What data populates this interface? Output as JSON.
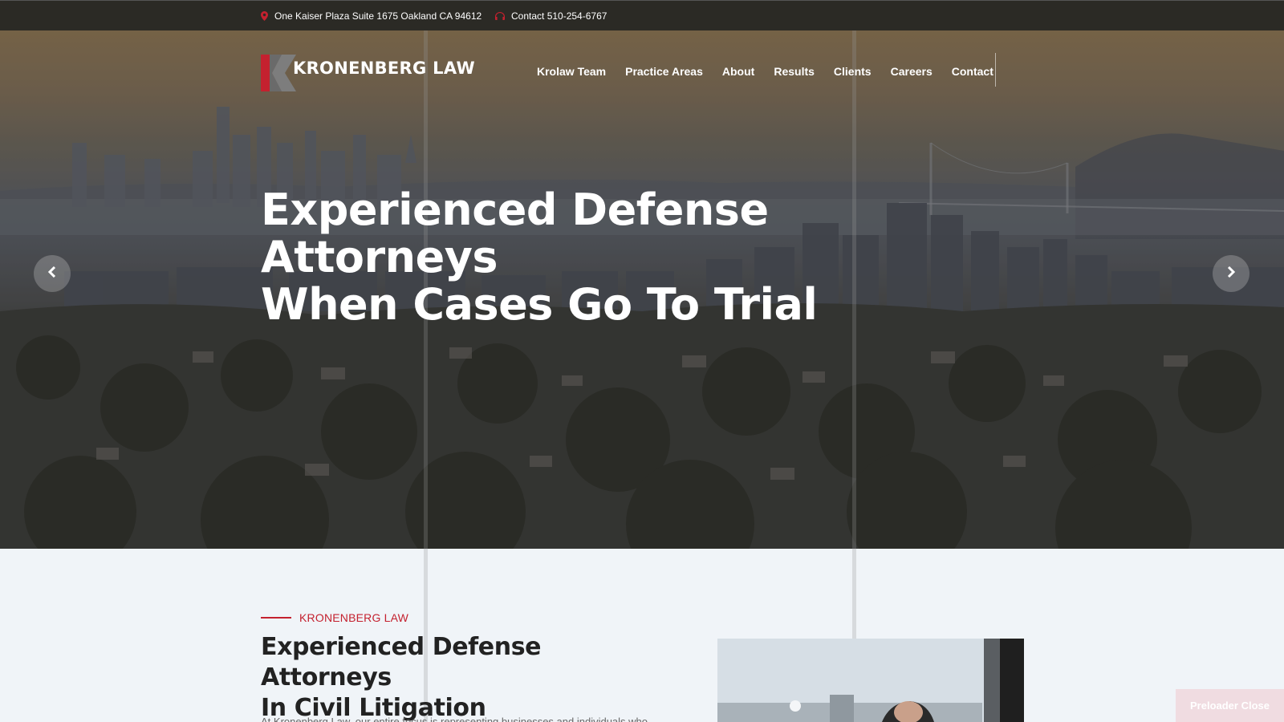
{
  "topbar": {
    "address": "One Kaiser Plaza Suite 1675 Oakland CA 94612",
    "contact": "Contact 510-254-6767",
    "address_icon": "map-pin-icon",
    "contact_icon": "headset-icon"
  },
  "brand": {
    "name": "KRONENBERG LAW",
    "accent_color": "#c4212f"
  },
  "nav": {
    "items": [
      "Krolaw Team",
      "Practice Areas",
      "About",
      "Results",
      "Clients",
      "Careers",
      "Contact"
    ]
  },
  "hero": {
    "title_line1": "Experienced Defense Attorneys",
    "title_line2": "When Cases Go To Trial",
    "prev_icon": "chevron-left-icon",
    "next_icon": "chevron-right-icon"
  },
  "intro": {
    "eyebrow": "KRONENBERG LAW",
    "title_line1": "Experienced Defense Attorneys",
    "title_line2": "In Civil Litigation",
    "body": "At Kronenberg Law, our entire focus is representing businesses and individuals who"
  },
  "preloader": {
    "label": "Preloader Close"
  }
}
